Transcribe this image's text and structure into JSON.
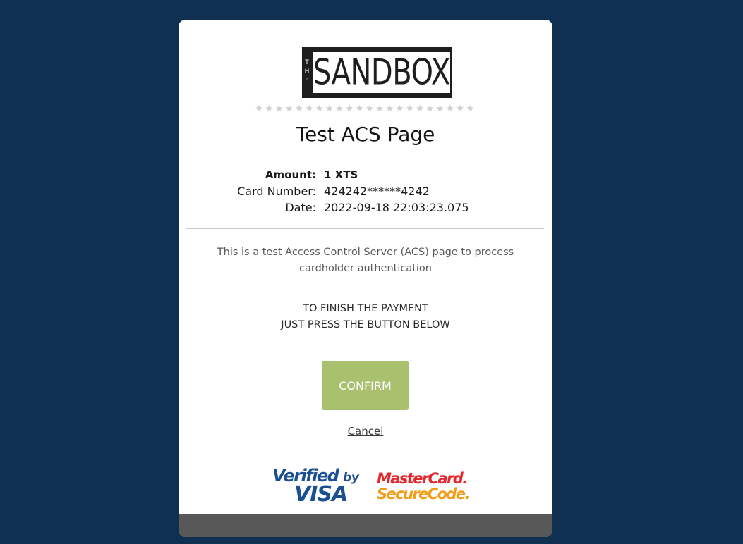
{
  "brand": {
    "logo_small": "THE",
    "logo_main": "SANDBOX"
  },
  "decoration": {
    "stars": "★★★★★★★★★★★★★★★★★★★★★★"
  },
  "page": {
    "title": "Test ACS Page"
  },
  "transaction": {
    "amount_label": "Amount:",
    "amount_value": "1 XTS",
    "card_label": "Card Number:",
    "card_value": "424242******4242",
    "date_label": "Date:",
    "date_value": "2022-09-18 22:03:23.075"
  },
  "info": {
    "line1": "This is a test Access Control Server (ACS) page to process",
    "line2": "cardholder authentication"
  },
  "instructions": {
    "line1": "TO FINISH THE PAYMENT",
    "line2": "JUST PRESS THE BUTTON BELOW"
  },
  "actions": {
    "confirm_label": "CONFIRM",
    "cancel_label": "Cancel"
  },
  "badges": {
    "visa_line1_a": "Verified",
    "visa_line1_b": "by",
    "visa_line2": "VISA",
    "mc_line1": "MasterCard.",
    "mc_line2": "SecureCode."
  },
  "colors": {
    "background": "#0f3050",
    "confirm": "#a9c16e",
    "footer": "#585858"
  }
}
